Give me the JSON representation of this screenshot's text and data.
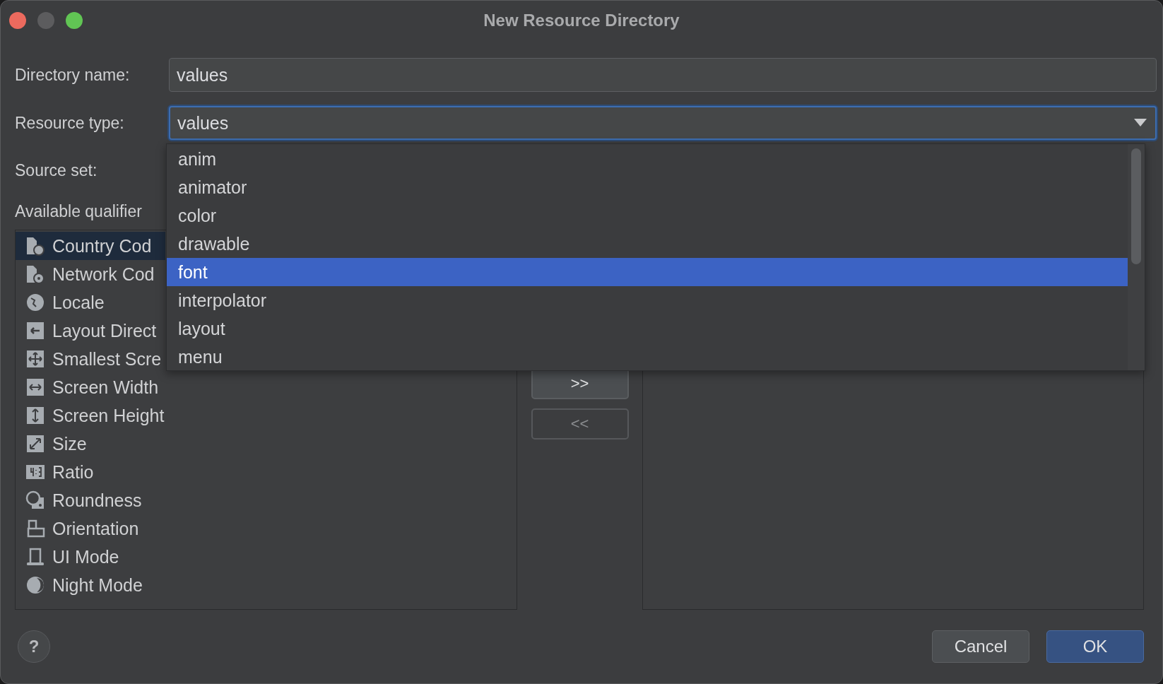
{
  "window": {
    "title": "New Resource Directory"
  },
  "directory_name": {
    "label": "Directory name:",
    "value": "values"
  },
  "resource_type": {
    "label": "Resource type:",
    "value": "values",
    "expanded": true,
    "options": [
      {
        "label": "anim",
        "selected": false
      },
      {
        "label": "animator",
        "selected": false
      },
      {
        "label": "color",
        "selected": false
      },
      {
        "label": "drawable",
        "selected": false
      },
      {
        "label": "font",
        "selected": true
      },
      {
        "label": "interpolator",
        "selected": false
      },
      {
        "label": "layout",
        "selected": false
      },
      {
        "label": "menu",
        "selected": false
      }
    ]
  },
  "source_set": {
    "label": "Source set:"
  },
  "available_qualifiers": {
    "label": "Available qualifier",
    "items": [
      {
        "label": "Country Cod",
        "selected": true
      },
      {
        "label": "Network Cod",
        "selected": false
      },
      {
        "label": "Locale",
        "selected": false
      },
      {
        "label": "Layout Direct",
        "selected": false
      },
      {
        "label": "Smallest Scre",
        "selected": false
      },
      {
        "label": "Screen Width",
        "selected": false
      },
      {
        "label": "Screen Height",
        "selected": false
      },
      {
        "label": "Size",
        "selected": false
      },
      {
        "label": "Ratio",
        "selected": false
      },
      {
        "label": "Roundness",
        "selected": false
      },
      {
        "label": "Orientation",
        "selected": false
      },
      {
        "label": "UI Mode",
        "selected": false
      },
      {
        "label": "Night Mode",
        "selected": false
      }
    ]
  },
  "move_buttons": [
    {
      "label": ">>",
      "disabled": false
    },
    {
      "label": "<<",
      "disabled": true
    }
  ],
  "help": {
    "label": "?"
  },
  "buttons": [
    {
      "label": "Cancel",
      "kind": "secondary"
    },
    {
      "label": "OK",
      "kind": "primary"
    }
  ]
}
